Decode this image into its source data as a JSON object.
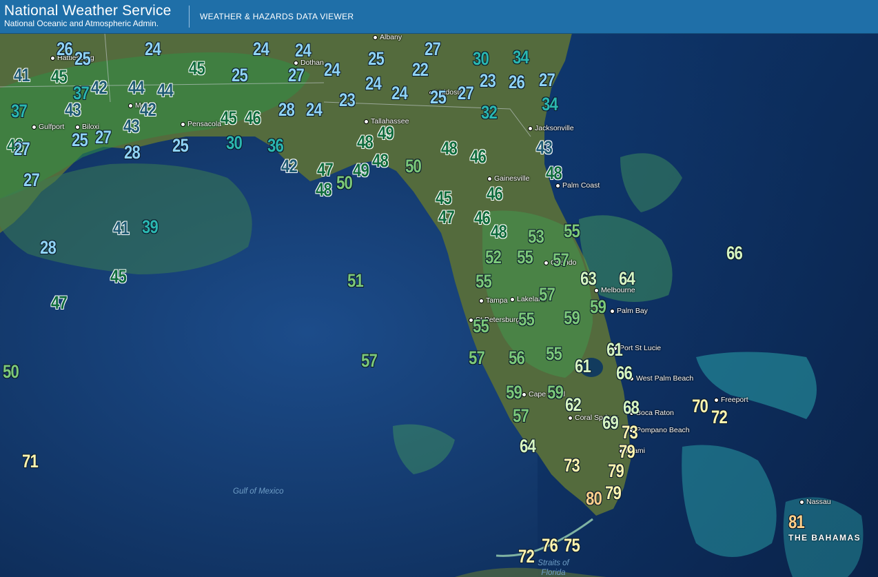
{
  "header": {
    "brand_title": "National Weather Service",
    "brand_subtitle": "National Oceanic and Atmospheric Admin.",
    "app_title": "WEATHER & HAZARDS DATA VIEWER"
  },
  "colors": {
    "header_bg": "#1f6fa8",
    "temp_bands": {
      "20s": "#8fd3f5",
      "30s": "#2bb7b0",
      "40s": "#1f5a72",
      "45-49": "#0f6b3c",
      "50-59": "#7cc97a",
      "60s": "#d6f5c2",
      "70s": "#fff5b0",
      "80s": "#ffd08a"
    }
  },
  "cities": [
    {
      "name": "Albany"
    },
    {
      "name": "Dothan"
    },
    {
      "name": "Valdosta"
    },
    {
      "name": "Tallahassee"
    },
    {
      "name": "Jacksonville"
    },
    {
      "name": "Gainesville"
    },
    {
      "name": "Palm Coast"
    },
    {
      "name": "Orlando"
    },
    {
      "name": "Melbourne"
    },
    {
      "name": "Palm Bay"
    },
    {
      "name": "Tampa"
    },
    {
      "name": "Lakeland"
    },
    {
      "name": "St Petersburg"
    },
    {
      "name": "Port St Lucie"
    },
    {
      "name": "West Palm Beach"
    },
    {
      "name": "Boca Raton"
    },
    {
      "name": "Coral Springs"
    },
    {
      "name": "Pompano Beach"
    },
    {
      "name": "Miami"
    },
    {
      "name": "Cape Coral"
    },
    {
      "name": "Gulfport"
    },
    {
      "name": "Biloxi"
    },
    {
      "name": "Pensacola"
    },
    {
      "name": "Mobile"
    },
    {
      "name": "Hattiesburg"
    },
    {
      "name": "Freeport"
    },
    {
      "name": "Nassau"
    }
  ],
  "water_labels": [
    "Gulf of Mexico",
    "Straits of Florida"
  ],
  "country_label": "THE BAHAMAS",
  "temperatures": [
    "26",
    "24",
    "24",
    "24",
    "25",
    "25",
    "27",
    "30",
    "34",
    "41",
    "45",
    "45",
    "25",
    "27",
    "24",
    "24",
    "22",
    "23",
    "26",
    "27",
    "37",
    "43",
    "42",
    "44",
    "44",
    "42",
    "28",
    "24",
    "23",
    "24",
    "25",
    "27",
    "32",
    "34",
    "37",
    "46",
    "45",
    "46",
    "43",
    "27",
    "25",
    "27",
    "28",
    "25",
    "30",
    "36",
    "48",
    "49",
    "48",
    "46",
    "43",
    "27",
    "42",
    "47",
    "49",
    "48",
    "50",
    "48",
    "41",
    "39",
    "28",
    "48",
    "50",
    "45",
    "46",
    "47",
    "46",
    "48",
    "53",
    "55",
    "45",
    "51",
    "52",
    "55",
    "57",
    "55",
    "63",
    "64",
    "47",
    "57",
    "59",
    "55",
    "55",
    "59",
    "50",
    "57",
    "57",
    "56",
    "55",
    "61",
    "61",
    "66",
    "59",
    "59",
    "62",
    "68",
    "70",
    "72",
    "57",
    "69",
    "73",
    "71",
    "64",
    "79",
    "73",
    "79",
    "80",
    "79",
    "81",
    "72",
    "76",
    "75",
    "66"
  ]
}
